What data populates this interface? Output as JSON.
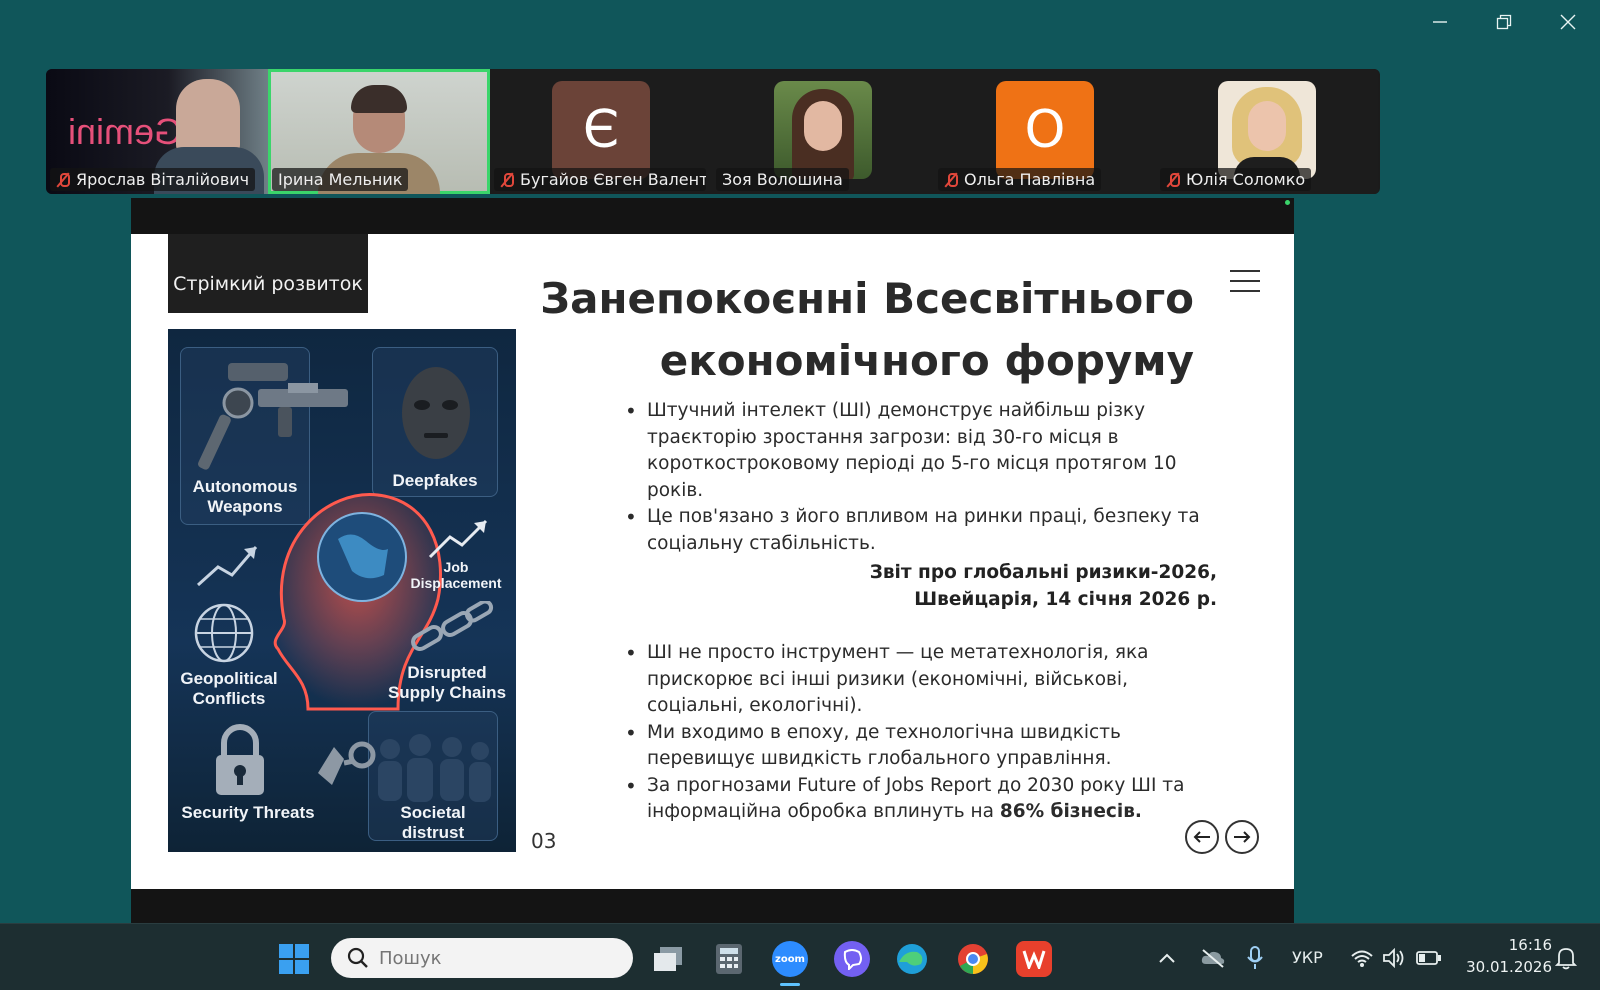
{
  "window_controls": [
    "minimize-icon",
    "restore-icon",
    "close-icon"
  ],
  "participants": [
    {
      "name": "Ярослав Віталійович",
      "muted": true,
      "type": "video",
      "overlay_text": "Gemini",
      "speaking": false
    },
    {
      "name": "Ірина Мельник",
      "muted": false,
      "type": "video",
      "speaking": true
    },
    {
      "name": "Бугайов Євген Валент...",
      "muted": true,
      "type": "initial",
      "initial": "Є",
      "color": "#6b4338",
      "speaking": false
    },
    {
      "name": "Зоя Волошина",
      "muted": false,
      "type": "photo",
      "speaking": false
    },
    {
      "name": "Ольга Павлівна",
      "muted": true,
      "type": "initial",
      "initial": "О",
      "color": "#ef7215",
      "speaking": false
    },
    {
      "name": "Юлія Соломко",
      "muted": true,
      "type": "photo",
      "speaking": false
    }
  ],
  "slide": {
    "tag": "Стрімкий розвиток",
    "title_line1": "Занепокоєнні Всесвітнього",
    "title_line2": "економічного форуму",
    "image_labels": {
      "autonomous_weapons": "Autonomous Weapons",
      "deepfakes": "Deepfakes",
      "job_displacement": "Job Displacement",
      "geopolitical_conflicts": "Geopolitical Conflicts",
      "disrupted_supply_chains": "Disrupted Supply Chains",
      "security_threats": "Security Threats",
      "societal_distrust": "Societal distrust"
    },
    "bullets_top": [
      "Штучний інтелект (ШІ) демонструє найбільш різку траєкторію зростання загрози: від 30-го місця в короткостроковому періоді до 5-го місця протягом 10 років.",
      "Це пов'язано з його впливом на ринки праці, безпеку та соціальну стабільність."
    ],
    "report_line1": "Звіт про глобальні ризики-2026,",
    "report_line2": "Швейцарія, 14 січня 2026 р.",
    "bullets_bottom": [
      "ШІ не просто інструмент — це метатехнологія, яка прискорює всі інші ризики (економічні, військові, соціальні, екологічні).",
      "Ми входимо в епоху, де технологічна швидкість перевищує швидкість глобального управління."
    ],
    "bullet_last_prefix": "За прогнозами Future of Jobs Report до 2030 року ШІ та інформаційна обробка вплинуть на ",
    "bullet_last_bold": "86% бізнесів.",
    "page_number": "03",
    "prev_icon": "arrow-left-icon",
    "next_icon": "arrow-right-icon"
  },
  "taskbar": {
    "search_placeholder": "Пошук",
    "apps": [
      "windows-start-icon",
      "task-view-icon",
      "calculator-icon",
      "zoom-icon",
      "viber-icon",
      "edge-icon",
      "chrome-icon",
      "wps-office-icon"
    ],
    "zoom_label": "zoom",
    "language": "УКР",
    "time": "16:16",
    "date": "30.01.2026"
  },
  "colors": {
    "desktop": "#10565a",
    "speaking_border": "#3bd56b",
    "mute_red": "#e0473b",
    "taskbar": "#1d2e31"
  }
}
